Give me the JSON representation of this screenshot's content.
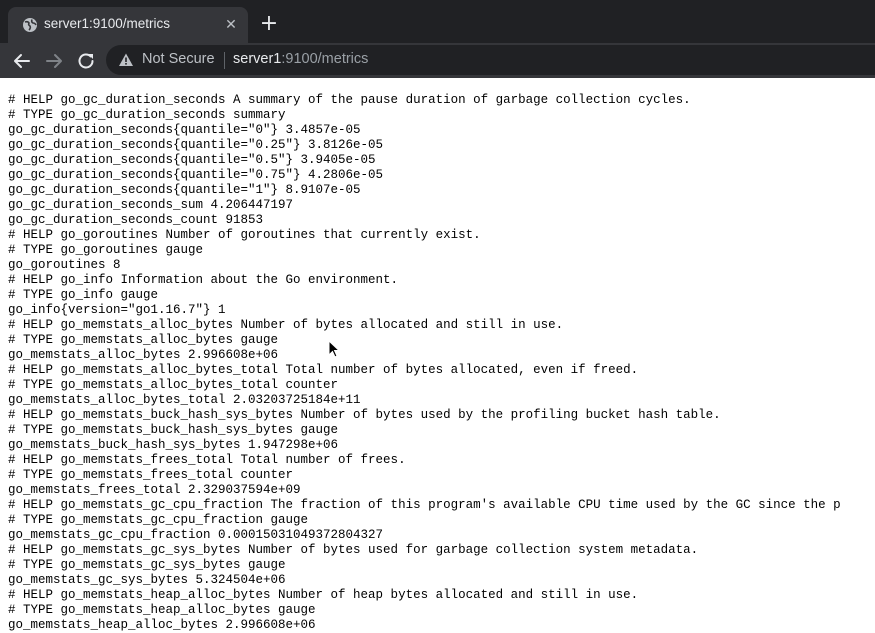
{
  "tab": {
    "title": "server1:9100/metrics",
    "favicon": "globe-icon",
    "close_icon": "close-icon",
    "new_tab_icon": "plus-icon"
  },
  "toolbar": {
    "back_icon": "arrow-left-icon",
    "forward_icon": "arrow-right-icon",
    "reload_icon": "reload-icon",
    "security_icon": "warning-triangle-icon",
    "security_label": "Not Secure",
    "url_host": "server1",
    "url_path": ":9100/metrics"
  },
  "colors": {
    "tabstrip_bg": "#202124",
    "tab_active_bg": "#35363a",
    "omnibox_bg": "#202124",
    "page_bg": "#ffffff",
    "text": "#000000"
  },
  "content": {
    "lines": [
      "# HELP go_gc_duration_seconds A summary of the pause duration of garbage collection cycles.",
      "# TYPE go_gc_duration_seconds summary",
      "go_gc_duration_seconds{quantile=\"0\"} 3.4857e-05",
      "go_gc_duration_seconds{quantile=\"0.25\"} 3.8126e-05",
      "go_gc_duration_seconds{quantile=\"0.5\"} 3.9405e-05",
      "go_gc_duration_seconds{quantile=\"0.75\"} 4.2806e-05",
      "go_gc_duration_seconds{quantile=\"1\"} 8.9107e-05",
      "go_gc_duration_seconds_sum 4.206447197",
      "go_gc_duration_seconds_count 91853",
      "# HELP go_goroutines Number of goroutines that currently exist.",
      "# TYPE go_goroutines gauge",
      "go_goroutines 8",
      "# HELP go_info Information about the Go environment.",
      "# TYPE go_info gauge",
      "go_info{version=\"go1.16.7\"} 1",
      "# HELP go_memstats_alloc_bytes Number of bytes allocated and still in use.",
      "# TYPE go_memstats_alloc_bytes gauge",
      "go_memstats_alloc_bytes 2.996608e+06",
      "# HELP go_memstats_alloc_bytes_total Total number of bytes allocated, even if freed.",
      "# TYPE go_memstats_alloc_bytes_total counter",
      "go_memstats_alloc_bytes_total 2.03203725184e+11",
      "# HELP go_memstats_buck_hash_sys_bytes Number of bytes used by the profiling bucket hash table.",
      "# TYPE go_memstats_buck_hash_sys_bytes gauge",
      "go_memstats_buck_hash_sys_bytes 1.947298e+06",
      "# HELP go_memstats_frees_total Total number of frees.",
      "# TYPE go_memstats_frees_total counter",
      "go_memstats_frees_total 2.329037594e+09",
      "# HELP go_memstats_gc_cpu_fraction The fraction of this program's available CPU time used by the GC since the p",
      "# TYPE go_memstats_gc_cpu_fraction gauge",
      "go_memstats_gc_cpu_fraction 0.00015031049372804327",
      "# HELP go_memstats_gc_sys_bytes Number of bytes used for garbage collection system metadata.",
      "# TYPE go_memstats_gc_sys_bytes gauge",
      "go_memstats_gc_sys_bytes 5.324504e+06",
      "# HELP go_memstats_heap_alloc_bytes Number of heap bytes allocated and still in use.",
      "# TYPE go_memstats_heap_alloc_bytes gauge",
      "go_memstats_heap_alloc_bytes 2.996608e+06"
    ]
  }
}
